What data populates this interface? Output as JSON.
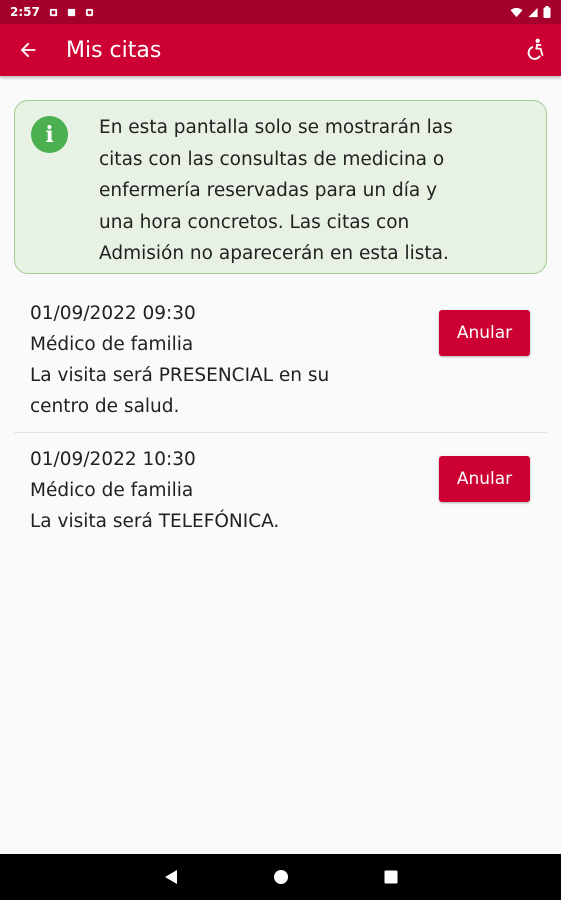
{
  "status_bar": {
    "time": "2:57",
    "icons": [
      "notification-icon",
      "notification-icon",
      "notification-icon",
      "wifi-icon",
      "signal-icon",
      "battery-icon"
    ]
  },
  "app_bar": {
    "title": "Mis citas",
    "back_icon": "arrow-left-icon",
    "accessibility_icon": "accessibility-icon"
  },
  "info": {
    "icon": "info-icon",
    "lines": [
      "En esta pantalla solo se mostrarán las",
      "citas con las consultas de medicina o",
      "enfermería reservadas para un día y",
      "una hora concretos. Las citas con",
      "Admisión no aparecerán en esta lista."
    ]
  },
  "appointments": [
    {
      "datetime": "01/09/2022 09:30",
      "specialty": "Médico de familia",
      "mode_lines": [
        "La visita será PRESENCIAL en su",
        "centro de salud."
      ],
      "cancel_label": "Anular"
    },
    {
      "datetime": "01/09/2022 10:30",
      "specialty": "Médico de familia",
      "mode_lines": [
        "La visita será TELEFÓNICA."
      ],
      "cancel_label": "Anular"
    }
  ],
  "colors": {
    "primary": "#cc0033",
    "status_bar": "#a5002c",
    "info_background": "#e8f2e4",
    "info_border": "#9dcf92",
    "info_icon": "#4caf50"
  }
}
